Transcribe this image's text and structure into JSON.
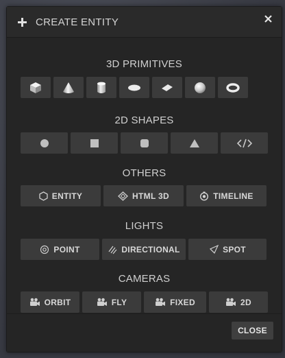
{
  "dialog": {
    "title": "CREATE ENTITY",
    "close_label": "CLOSE"
  },
  "sections": {
    "primitives": {
      "title": "3D PRIMITIVES",
      "items": [
        "box-icon",
        "cone-icon",
        "cylinder-icon",
        "disc-icon",
        "plane-icon",
        "sphere-icon",
        "torus-icon"
      ]
    },
    "shapes2d": {
      "title": "2D SHAPES",
      "items": [
        "circle-icon",
        "square-icon",
        "rounded-square-icon",
        "triangle-icon",
        "code-icon"
      ]
    },
    "others": {
      "title": "OTHERS",
      "items": [
        {
          "label": "ENTITY",
          "icon": "hexagon-icon"
        },
        {
          "label": "HTML 3D",
          "icon": "diamond-icon"
        },
        {
          "label": "TIMELINE",
          "icon": "timer-icon"
        }
      ]
    },
    "lights": {
      "title": "LIGHTS",
      "items": [
        {
          "label": "POINT",
          "icon": "target-icon"
        },
        {
          "label": "DIRECTIONAL",
          "icon": "rays-icon"
        },
        {
          "label": "SPOT",
          "icon": "spot-cone-icon"
        }
      ]
    },
    "cameras": {
      "title": "CAMERAS",
      "items": [
        {
          "label": "ORBIT",
          "icon": "camera-icon"
        },
        {
          "label": "FLY",
          "icon": "camera-icon"
        },
        {
          "label": "FIXED",
          "icon": "camera-icon"
        },
        {
          "label": "2D",
          "icon": "camera-icon"
        }
      ]
    }
  },
  "colors": {
    "dialog_bg": "#252525",
    "button_bg": "#3b3b3b",
    "text": "#d8d8d8"
  }
}
